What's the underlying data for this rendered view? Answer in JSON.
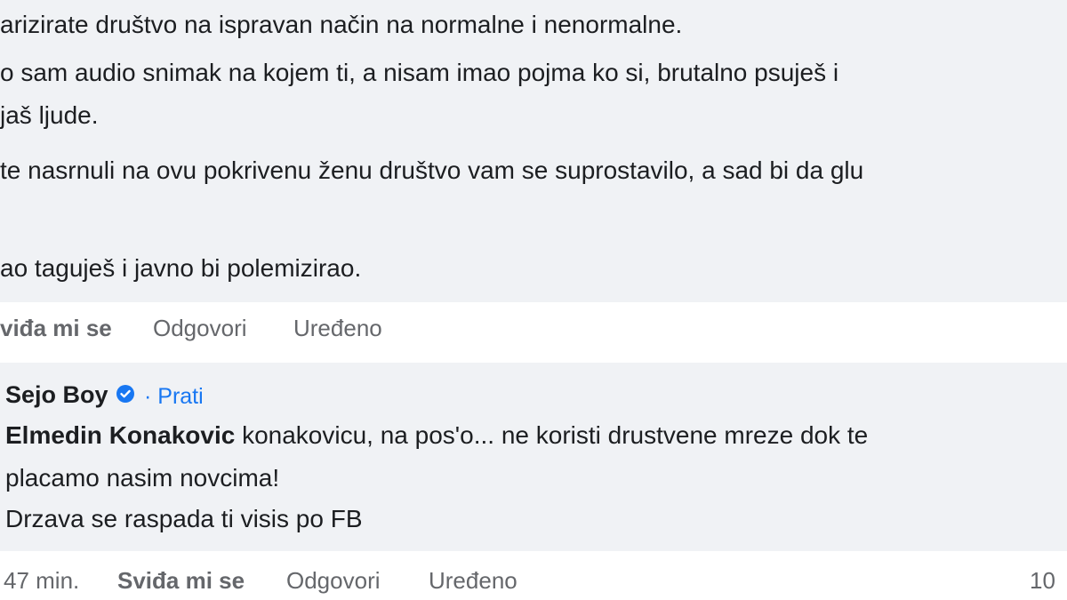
{
  "comment_top": {
    "lines": [
      "arizirate društvo na ispravan način na normalne i nenormalne.",
      "o sam audio snimak na kojem ti, a nisam imao pojma ko si, brutalno psuješ i",
      "jaš ljude.",
      "te nasrnuli na ovu pokrivenu ženu društvo vam se suprostavilo, a sad bi da glu",
      "ao taguješ i javno bi polemizirao."
    ],
    "actions": {
      "like": "viđa mi se",
      "reply": "Odgovori",
      "edited": "Uređeno"
    }
  },
  "comment_bottom": {
    "author": "Sejo Boy",
    "follow": "· Prati",
    "tagged_name": "Elmedin Konakovic",
    "line1_rest": " konakovicu, na pos'o... ne koristi drustvene mreze dok te",
    "line2": "placamo nasim novcima!",
    "line3": "Drzava se raspada ti visis po FB",
    "actions": {
      "time": "47 min.",
      "like": "Sviđa mi se",
      "reply": "Odgovori",
      "edited": "Uređeno",
      "reaction_count": "10"
    }
  },
  "colors": {
    "bubble": "#f0f2f5",
    "text": "#1c1e21",
    "muted": "#65676b",
    "link": "#1877f2"
  },
  "icons": [
    "verified-badge-icon"
  ]
}
